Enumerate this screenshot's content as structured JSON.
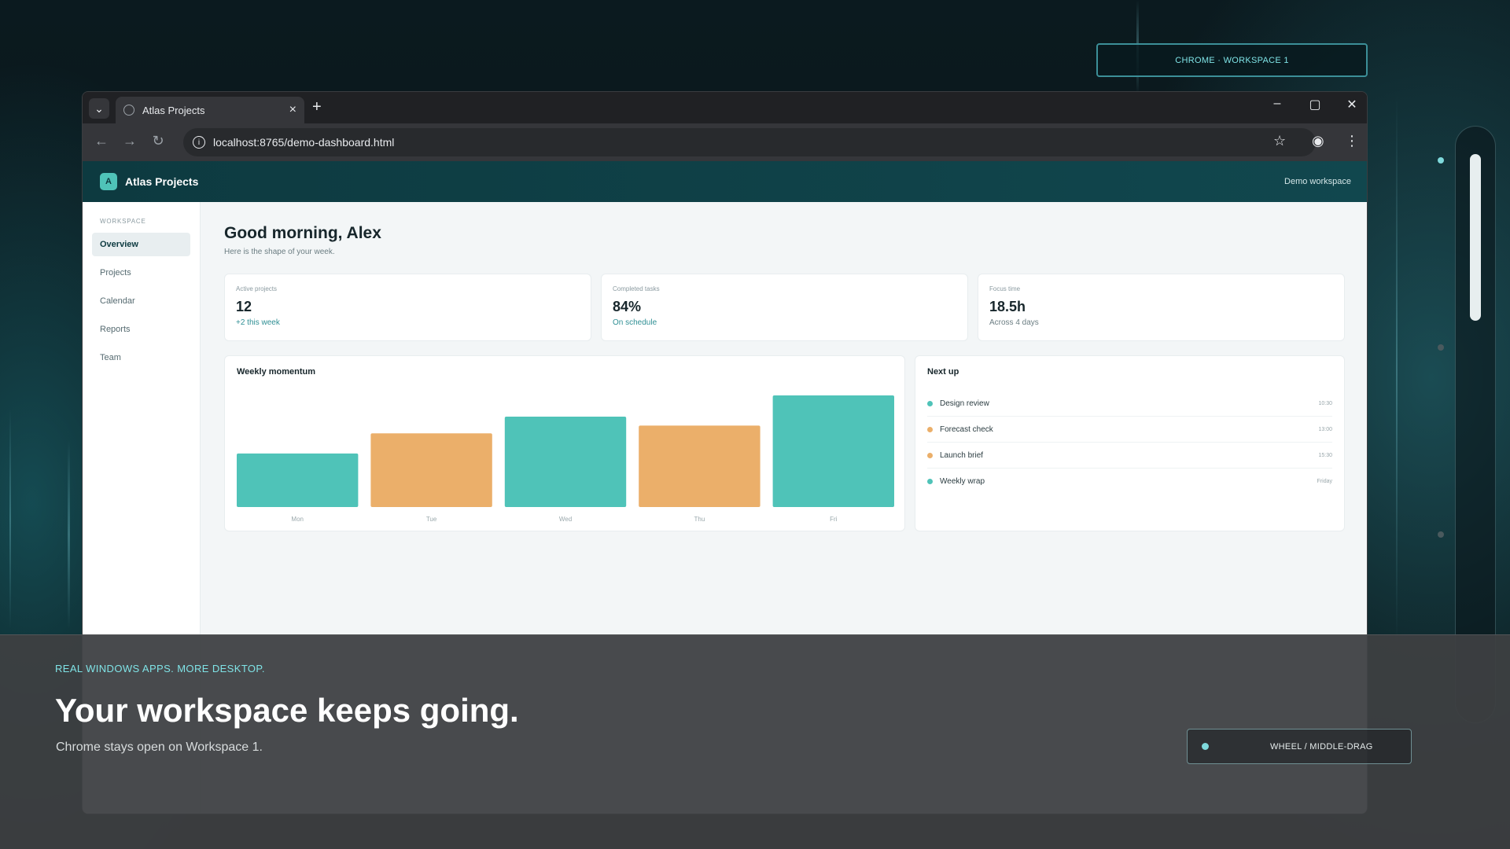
{
  "colors": {
    "accent": "#2f8f94",
    "teal_bar": "#4fc3b8",
    "orange_bar": "#ebaf6a",
    "header_bg": "#0d3a40"
  },
  "workspace_pill": "CHROME · WORKSPACE 1",
  "browser": {
    "tab_title": "Atlas Projects",
    "url": "localhost:8765/demo-dashboard.html"
  },
  "app": {
    "logo_letter": "A",
    "name": "Atlas Projects",
    "workspace_label": "Demo workspace"
  },
  "sidebar": {
    "section": "WORKSPACE",
    "items": [
      {
        "label": "Overview",
        "active": true
      },
      {
        "label": "Projects",
        "active": false
      },
      {
        "label": "Calendar",
        "active": false
      },
      {
        "label": "Reports",
        "active": false
      },
      {
        "label": "Team",
        "active": false
      }
    ]
  },
  "main": {
    "greeting": "Good morning, Alex",
    "subtitle": "Here is the shape of your week."
  },
  "stats": [
    {
      "label": "Active projects",
      "value": "12",
      "sub": "+2 this week",
      "sub_style": "accent"
    },
    {
      "label": "Completed tasks",
      "value": "84%",
      "sub": "On schedule",
      "sub_style": "accent"
    },
    {
      "label": "Focus time",
      "value": "18.5h",
      "sub": "Across 4 days",
      "sub_style": "muted"
    }
  ],
  "chart_panel": {
    "title": "Weekly momentum"
  },
  "chart_data": {
    "type": "bar",
    "categories": [
      "Mon",
      "Tue",
      "Wed",
      "Thu",
      "Fri"
    ],
    "values": [
      48,
      66,
      81,
      73,
      100
    ],
    "bar_colors": [
      "#4fc3b8",
      "#ebaf6a",
      "#4fc3b8",
      "#ebaf6a",
      "#4fc3b8"
    ],
    "ylim": [
      0,
      100
    ],
    "grid": false
  },
  "next_up": {
    "title": "Next up",
    "items": [
      {
        "name": "Design review",
        "time": "10:30",
        "color": "#4fc3b8"
      },
      {
        "name": "Forecast check",
        "time": "13:00",
        "color": "#ebaf6a"
      },
      {
        "name": "Launch brief",
        "time": "15:30",
        "color": "#ebaf6a"
      },
      {
        "name": "Weekly wrap",
        "time": "Friday",
        "color": "#4fc3b8"
      }
    ]
  },
  "caption": {
    "kicker": "REAL WINDOWS APPS. MORE DESKTOP.",
    "headline": "Your workspace keeps going.",
    "subline": "Chrome stays open on Workspace 1."
  },
  "hint": {
    "text": "WHEEL  /  MIDDLE-DRAG"
  }
}
